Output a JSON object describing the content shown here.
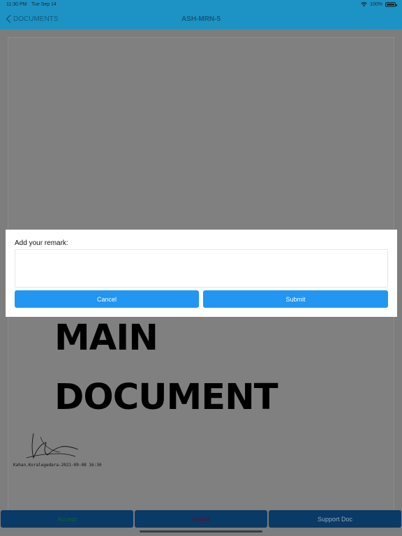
{
  "status_bar": {
    "time": "11:30 PM",
    "date": "Tue Sep 14",
    "battery": "100%",
    "icons": [
      "wifi-icon",
      "battery-icon"
    ]
  },
  "nav": {
    "back_label": "DOCUMENTS",
    "title": "ASH-MRN-5",
    "back_icon": "chevron-left-icon"
  },
  "document": {
    "heading_line1": "MAIN",
    "heading_line2": "DOCUMENT",
    "signature_caption": "Kahan.Koralegedara-2021-09-08 16:30"
  },
  "dialog": {
    "label": "Add your remark:",
    "input_value": "",
    "input_placeholder": "",
    "cancel_label": "Cancel",
    "submit_label": "Submit"
  },
  "bottom_bar": {
    "accept_label": "Accept",
    "reject_label": "Reject",
    "support_label": "Support Doc"
  },
  "colors": {
    "nav_bar": "#1c93c4",
    "dim_overlay": "#7d7d7d",
    "dialog_button": "#2196f3",
    "tab_button": "#0a3a66",
    "accept_text": "#10632f",
    "reject_text": "#6b0d1f"
  }
}
